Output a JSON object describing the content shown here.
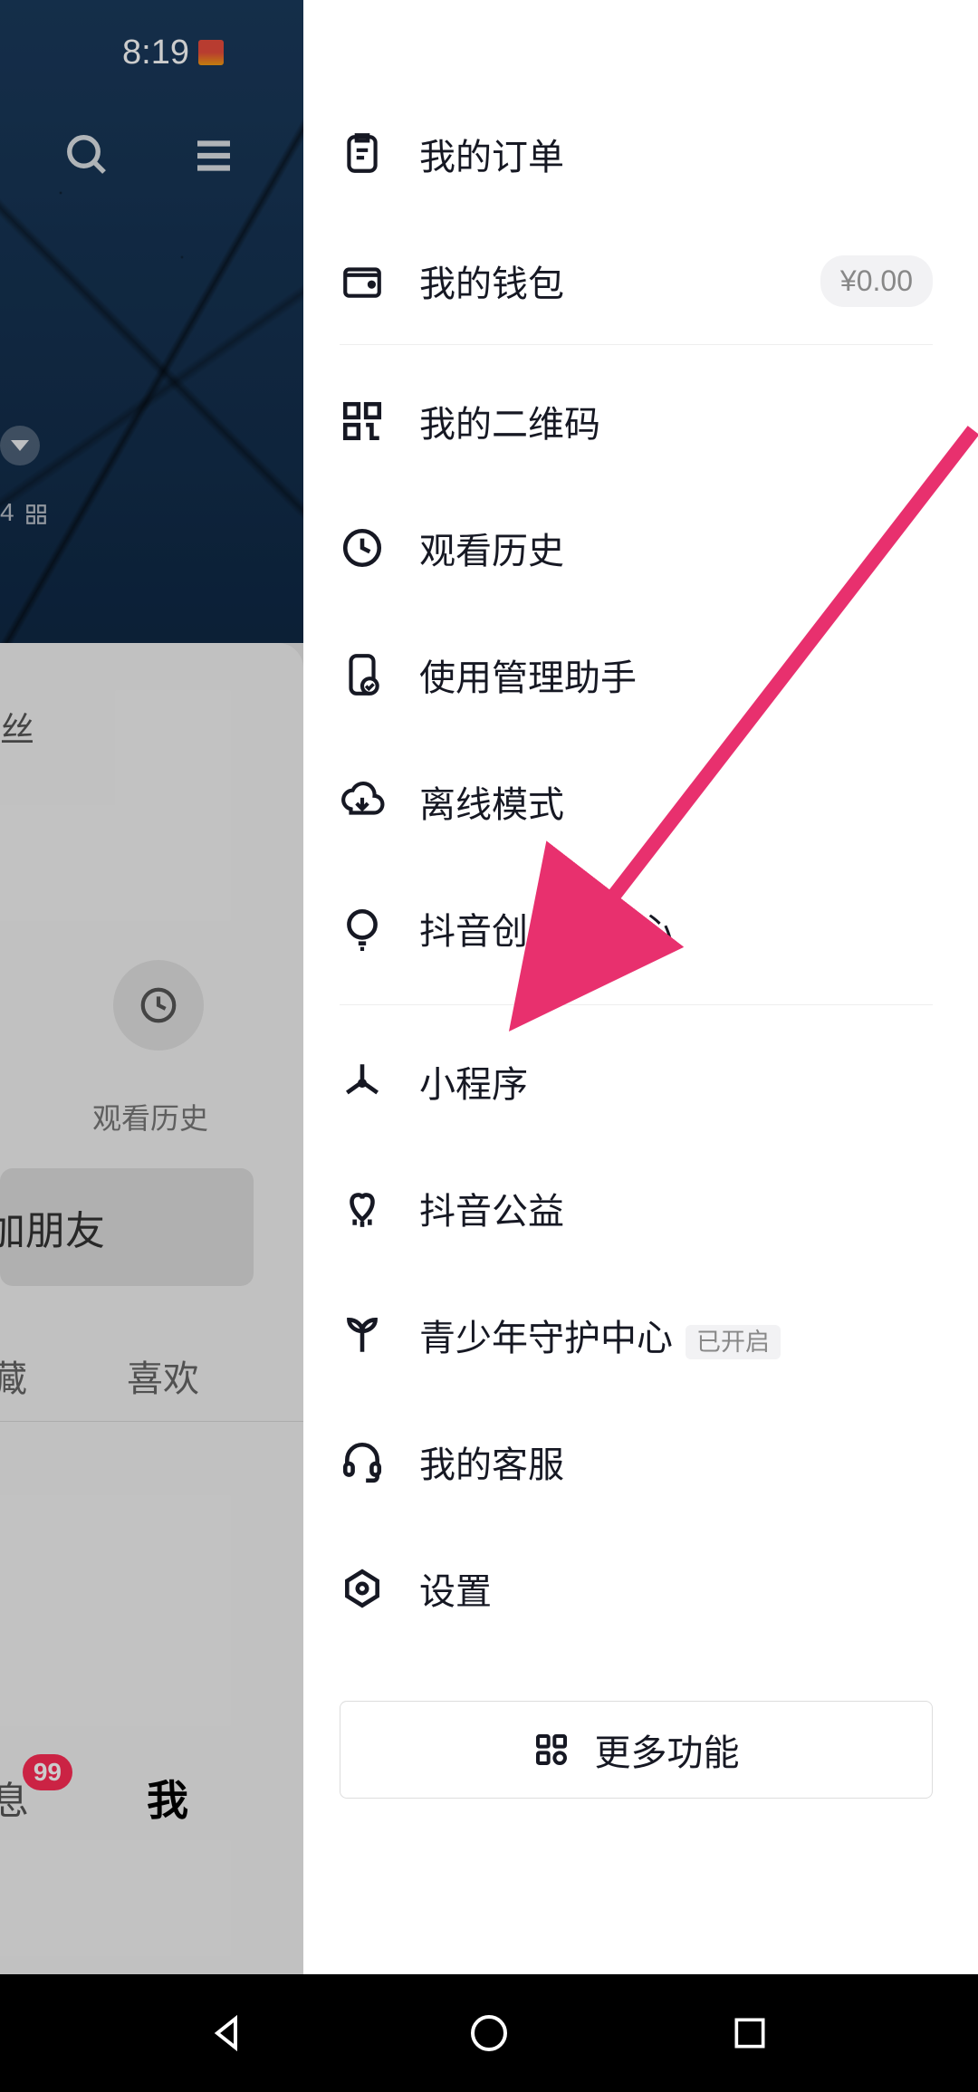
{
  "status": {
    "time": "8:19"
  },
  "bg": {
    "miniText": "4 ",
    "fragText": "丝",
    "historyLabel": "观看历史",
    "friendLabel": "加朋友",
    "tabFav": "藏",
    "tabLike": "喜欢",
    "navMsg": "息",
    "navMe": "我",
    "badge": "99"
  },
  "menu": {
    "orders": "我的订单",
    "wallet": "我的钱包",
    "walletAmount": "¥0.00",
    "qrcode": "我的二维码",
    "history": "观看历史",
    "manager": "使用管理助手",
    "offline": "离线模式",
    "creator": "抖音创作者中心",
    "miniapp": "小程序",
    "charity": "抖音公益",
    "youth": "青少年守护中心",
    "youthTag": "已开启",
    "service": "我的客服",
    "settings": "设置",
    "more": "更多功能"
  },
  "colors": {
    "accent": "#e8306e"
  }
}
